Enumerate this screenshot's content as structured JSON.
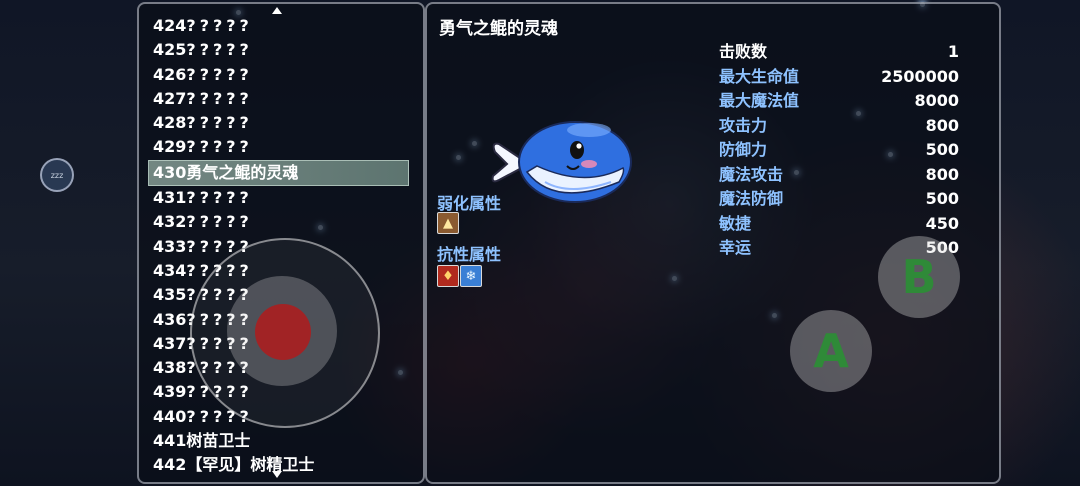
{
  "monster_book": {
    "entries": [
      {
        "number": "424",
        "name": "?????"
      },
      {
        "number": "425",
        "name": "?????"
      },
      {
        "number": "426",
        "name": "?????"
      },
      {
        "number": "427",
        "name": "?????"
      },
      {
        "number": "428",
        "name": "?????"
      },
      {
        "number": "429",
        "name": "?????"
      },
      {
        "number": "430",
        "name": "勇气之鲲的灵魂"
      },
      {
        "number": "431",
        "name": "?????"
      },
      {
        "number": "432",
        "name": "?????"
      },
      {
        "number": "433",
        "name": "?????"
      },
      {
        "number": "434",
        "name": "?????"
      },
      {
        "number": "435",
        "name": "?????"
      },
      {
        "number": "436",
        "name": "?????"
      },
      {
        "number": "437",
        "name": "?????"
      },
      {
        "number": "438",
        "name": "?????"
      },
      {
        "number": "439",
        "name": "?????"
      },
      {
        "number": "440",
        "name": "?????"
      },
      {
        "number": "441",
        "name": "树苗卫士"
      },
      {
        "number": "442",
        "name": "【罕见】树精卫士"
      }
    ],
    "selected_index": 6
  },
  "detail": {
    "title": "勇气之鲲的灵魂",
    "weak_label": "弱化属性",
    "weak_icons": [
      "earth-element-icon"
    ],
    "resist_label": "抗性属性",
    "resist_icons": [
      "fire-element-icon",
      "ice-element-icon"
    ],
    "stats": [
      {
        "label": "击败数",
        "value": "1"
      },
      {
        "label": "最大生命值",
        "value": "2500000"
      },
      {
        "label": "最大魔法值",
        "value": "8000"
      },
      {
        "label": "攻击力",
        "value": "800"
      },
      {
        "label": "防御力",
        "value": "500"
      },
      {
        "label": "魔法攻击",
        "value": "800"
      },
      {
        "label": "魔法防御",
        "value": "500"
      },
      {
        "label": "敏捷",
        "value": "450"
      },
      {
        "label": "幸运",
        "value": "500"
      }
    ]
  },
  "controls": {
    "a_label": "A",
    "b_label": "B",
    "sleep_label": "zzz"
  },
  "colors": {
    "accent_blue": "#8ec2ff",
    "selection": "#96afa5",
    "button_text_green": "#2f8a38",
    "joystick_knob": "#be1414"
  }
}
